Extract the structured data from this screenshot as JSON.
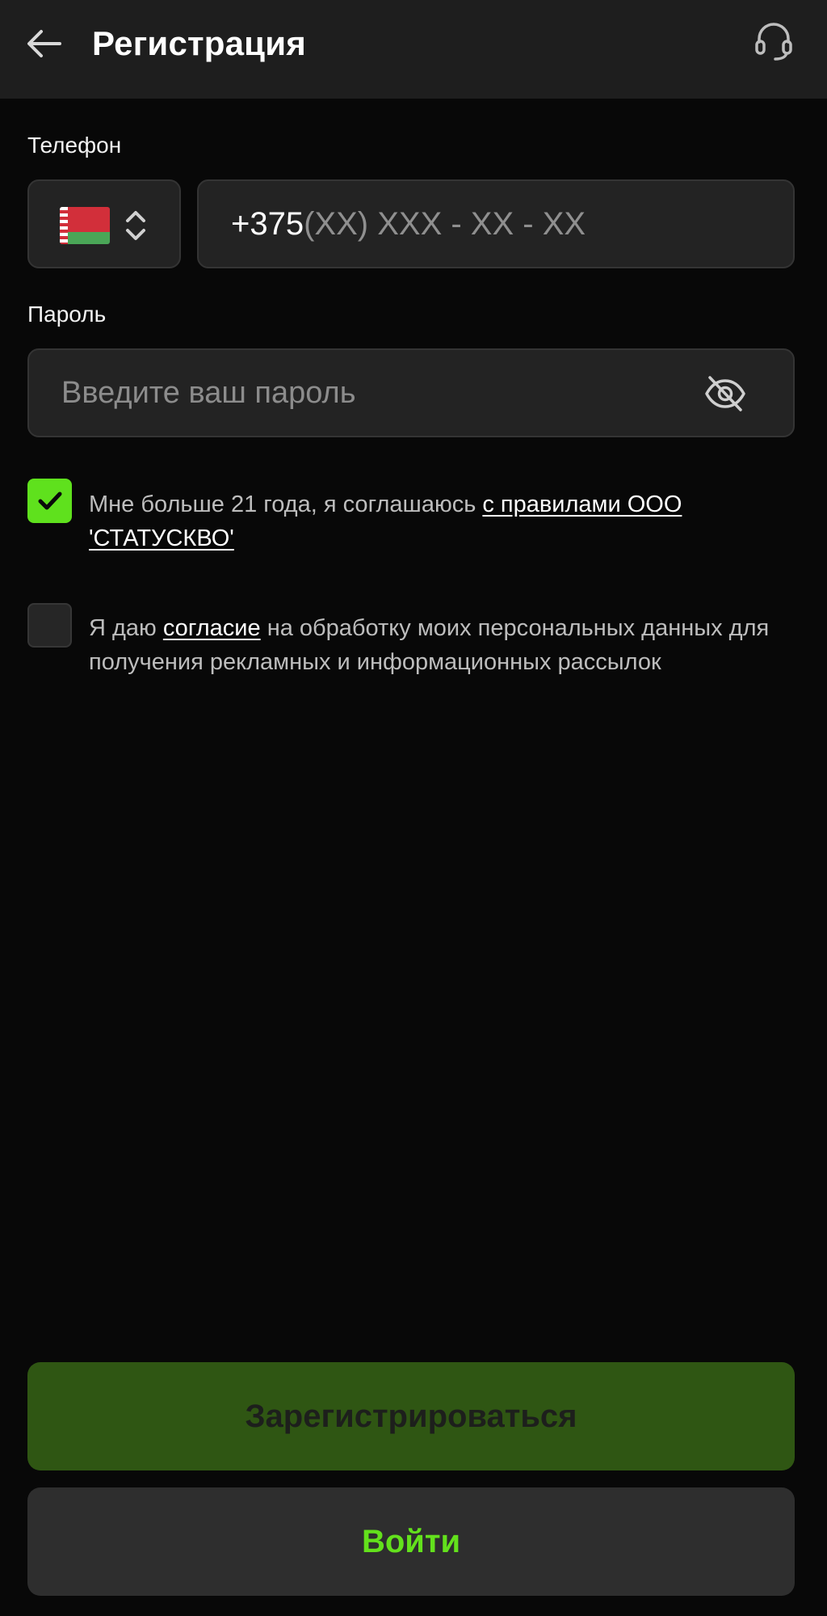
{
  "header": {
    "title": "Регистрация",
    "back_icon": "arrow-left-icon",
    "support_icon": "headset-icon"
  },
  "phone": {
    "label": "Телефон",
    "country_flag": "belarus-flag-icon",
    "selector_icon": "chevron-up-down-icon",
    "prefix": "+375",
    "mask": "(XX) XXX - XX - XX"
  },
  "password": {
    "label": "Пароль",
    "placeholder": "Введите ваш пароль",
    "value": "",
    "toggle_icon": "eye-off-icon"
  },
  "agreements": {
    "age": {
      "checked": true,
      "text": "Мне больше 21 года, я соглашаюсь ",
      "link": "с правилами ООО 'СТАТУСКВО'"
    },
    "marketing": {
      "checked": false,
      "text_before": "Я даю ",
      "link": "согласие",
      "text_after": " на обработку моих персональных данных для получения рекламных и информационных рассылок"
    }
  },
  "buttons": {
    "register": "Зарегистрироваться",
    "login": "Войти"
  },
  "colors": {
    "accent": "#5fe11d",
    "register_bg": "#2f5613",
    "login_text": "#63e11c",
    "header_bg": "#1e1e1e",
    "background": "#080808"
  }
}
